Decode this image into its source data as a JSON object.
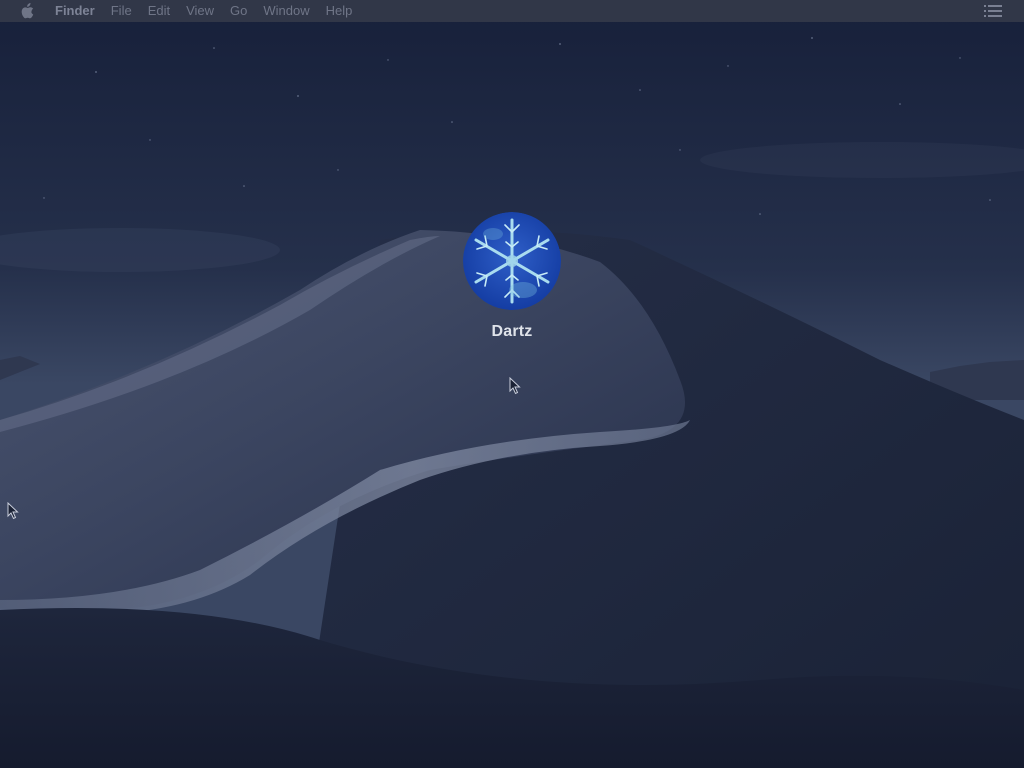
{
  "menubar": {
    "apple_icon": "apple-logo-icon",
    "app_name": "Finder",
    "menus": [
      "File",
      "Edit",
      "View",
      "Go",
      "Window",
      "Help"
    ],
    "right_icon": "list-menu-icon"
  },
  "login": {
    "username": "Dartz",
    "avatar_icon": "snowflake-avatar-icon"
  },
  "colors": {
    "menubar_bg": "#343a4a",
    "menu_text": "#6f7587",
    "username_text": "#dfe3ea",
    "sky": "#27324d",
    "dune": "#1a2238"
  }
}
